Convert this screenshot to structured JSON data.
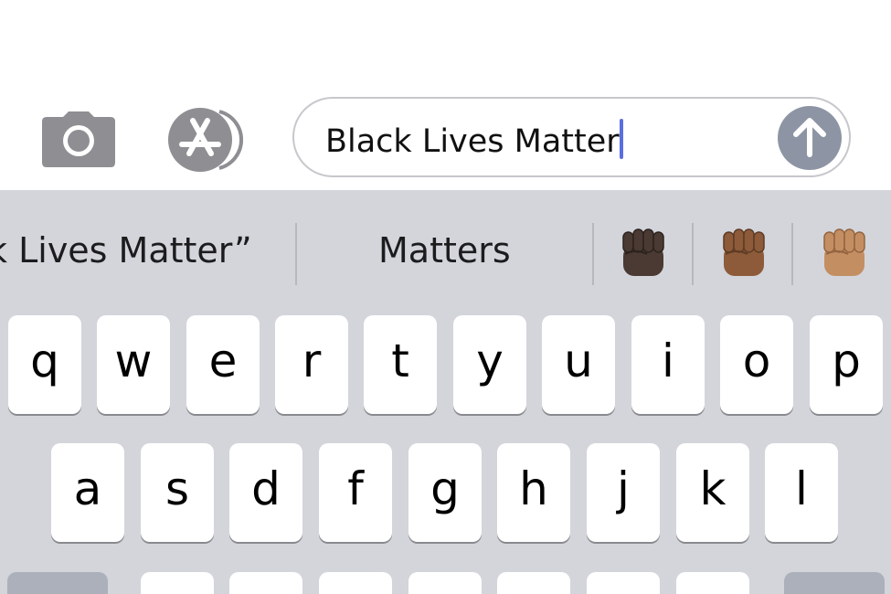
{
  "compose": {
    "message_text": "Black Lives Matter",
    "icons": {
      "camera": "camera-icon",
      "apps": "app-store-icon",
      "send": "arrow-up-icon"
    },
    "colors": {
      "cursor": "#5b6ee1",
      "send_button": "#8d95a4",
      "icon_gray": "#8e8e93"
    }
  },
  "suggestions": {
    "quoted": "k Lives Matter”",
    "word": "Matters",
    "emoji": [
      {
        "name": "raised-fist-dark-skin-tone-icon",
        "color": "#4a3a33"
      },
      {
        "name": "raised-fist-medium-dark-skin-tone-icon",
        "color": "#8d5b3a"
      },
      {
        "name": "raised-fist-medium-skin-tone-icon",
        "color": "#c48e63"
      }
    ]
  },
  "keyboard": {
    "row1": [
      "q",
      "w",
      "e",
      "r",
      "t",
      "y",
      "u",
      "i",
      "o",
      "p"
    ],
    "row2": [
      "a",
      "s",
      "d",
      "f",
      "g",
      "h",
      "j",
      "k",
      "l"
    ],
    "colors": {
      "background": "#d3d5db",
      "key": "#ffffff",
      "key_dark": "#abb0ba"
    }
  }
}
